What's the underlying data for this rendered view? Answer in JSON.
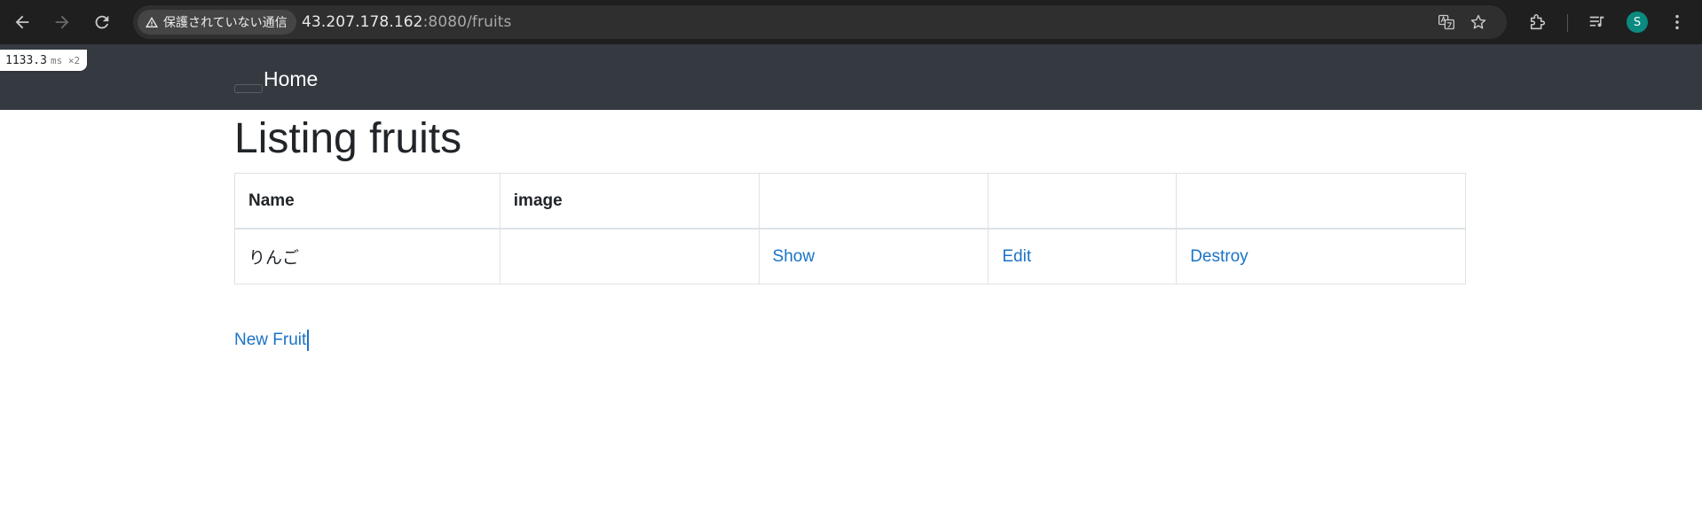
{
  "browser": {
    "security_label": "保護されていない通信",
    "url_host": "43.207.178.162",
    "url_path": ":8080/fruits",
    "profile_initial": "S"
  },
  "perf": {
    "value": "1133.3",
    "unit": "ms ×2"
  },
  "navbar": {
    "brand": "Home"
  },
  "page": {
    "title": "Listing fruits",
    "new_link": "New Fruit"
  },
  "table": {
    "headers": [
      "Name",
      "image",
      "",
      "",
      ""
    ],
    "rows": [
      {
        "name": "りんご",
        "image": "",
        "show": "Show",
        "edit": "Edit",
        "destroy": "Destroy"
      }
    ]
  }
}
